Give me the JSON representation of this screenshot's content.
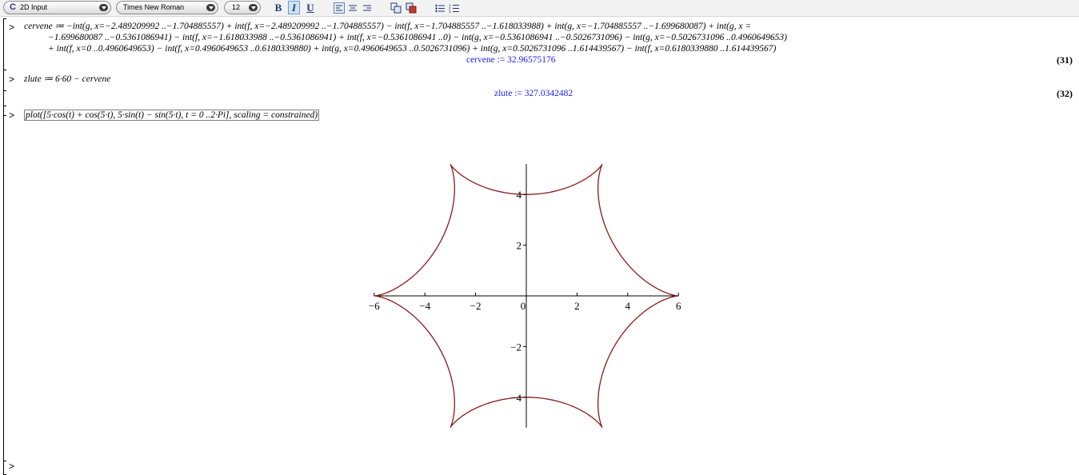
{
  "toolbar": {
    "input_mode": "2D Input",
    "font_family": "Times New Roman",
    "font_size": "12",
    "bold": "B",
    "italic": "I",
    "underline": "U",
    "accent": "#1b3a78"
  },
  "worksheet": {
    "prompt": ">",
    "cmd1": {
      "line1": "cervene ≔ −int(g, x=−2.489209992 ..−1.704885557) + int(f, x=−2.489209992 ..−1.704885557) − int(f, x=−1.704885557 ..−1.618033988) + int(g, x=−1.704885557 ..−1.699680087) + int(g, x =",
      "line2": "−1.699680087 ..−0.5361086941) − int(f, x=−1.618033988 ..−0.5361086941) + int(f, x=−0.5361086941 ..0) − int(g, x=−0.5361086941 ..−0.5026731096) − int(g, x=−0.5026731096 ..0.4960649653)",
      "line3": "+ int(f, x=0 ..0.4960649653) − int(f, x=0.4960649653 ..0.6180339880) + int(g, x=0.4960649653 ..0.5026731096) + int(g, x=0.5026731096 ..1.614439567) − int(f, x=0.6180339880 ..1.614439567)",
      "output": "cervene := 32.96575176",
      "label": "(31)"
    },
    "cmd2": {
      "input": "zlute ≔ 6·60 − cervene",
      "output": "zlute := 327.0342482",
      "label": "(32)"
    },
    "cmd3": {
      "input": "plot([5·cos(t) + cos(5·t), 5·sin(t) − sin(5·t), t = 0 ..2·Pi], scaling = constrained)"
    }
  },
  "chart_data": {
    "type": "line",
    "title": "",
    "xlabel": "",
    "ylabel": "",
    "series": [
      {
        "x_expr": "5*cos(t) + cos(5*t)",
        "y_expr": "5*sin(t) - sin(5*t)",
        "t_range": [
          0,
          6.283185307
        ],
        "samples": 600,
        "color": "#8b1a1a"
      }
    ],
    "xlim": [
      -6,
      6
    ],
    "ylim": [
      -5,
      5
    ],
    "x_ticks": [
      "-6",
      "-4",
      "-2",
      "0",
      "2",
      "4",
      "6"
    ],
    "y_ticks": [
      "-4",
      "-2",
      "2",
      "4"
    ],
    "grid": false,
    "legend": "none"
  }
}
